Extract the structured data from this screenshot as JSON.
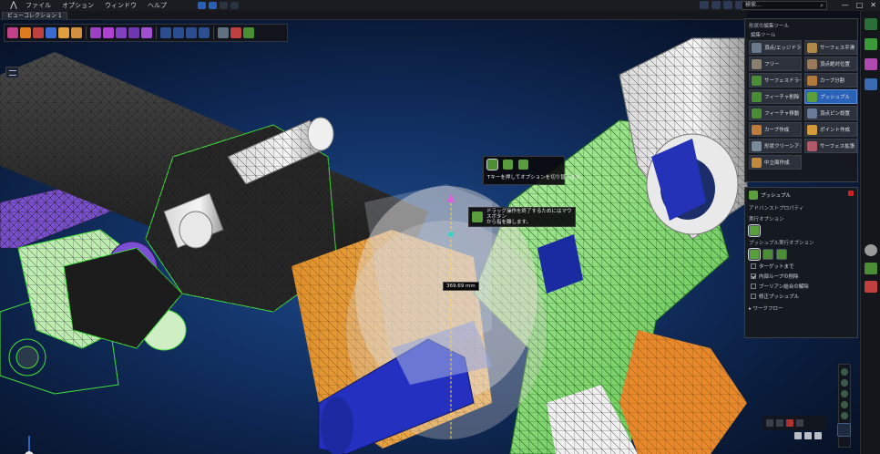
{
  "menubar": {
    "items": [
      "ファイル",
      "オプション",
      "ウィンドウ",
      "ヘルプ"
    ],
    "search_placeholder": "検索...",
    "window_controls": [
      "—",
      "□",
      "✕"
    ]
  },
  "tabs": {
    "active": "ビューコレクション 1"
  },
  "tooltips": {
    "toggle_text": "Tキーを押してオプションを切り替えます。",
    "drag_line1": "ドラッグ操作を終了するためにはマウスボタン",
    "drag_line2": "から指を離します。",
    "dimension": "369.69 mm"
  },
  "tools_panel": {
    "header": "形状の編集ツール",
    "sub_header": "編集ツール",
    "tools": [
      {
        "label": "頂点/エッジドラッグ",
        "icon": "drag-vertex-icon",
        "color": "#6a7a8a",
        "active": false
      },
      {
        "label": "サーフェス平滑",
        "icon": "smooth-surface-icon",
        "color": "#b08a48",
        "active": false
      },
      {
        "label": "フリー",
        "icon": "free-icon",
        "color": "#8a8070",
        "active": false
      },
      {
        "label": "頂点絶対位置",
        "icon": "vertex-absolute-icon",
        "color": "#9a7a5a",
        "active": false
      },
      {
        "label": "サーフェスドライブ",
        "icon": "surface-drive-icon",
        "color": "#4a8d34",
        "active": false
      },
      {
        "label": "カーブ分割",
        "icon": "curve-split-icon",
        "color": "#b27a3a",
        "active": false
      },
      {
        "label": "フィーチャ削除",
        "icon": "feature-delete-icon",
        "color": "#4a8d34",
        "active": false
      },
      {
        "label": "プッシュプル",
        "icon": "push-pull-icon",
        "color": "#5a9d3c",
        "active": true
      },
      {
        "label": "フィーチャ移動",
        "icon": "feature-move-icon",
        "color": "#4a8d34",
        "active": false
      },
      {
        "label": "頂点ピン設置",
        "icon": "vertex-pin-icon",
        "color": "#6a7a9a",
        "active": false
      },
      {
        "label": "カーブ作成",
        "icon": "curve-create-icon",
        "color": "#c07a3a",
        "active": false
      },
      {
        "label": "ポイント作成",
        "icon": "point-create-icon",
        "color": "#d49a3a",
        "active": false
      },
      {
        "label": "形状クリーンアップ",
        "icon": "cleanup-icon",
        "color": "#7a8a9a",
        "active": false
      },
      {
        "label": "サーフェス拡張",
        "icon": "surface-extend-icon",
        "color": "#b05a6a",
        "active": false
      },
      {
        "label": "中立面作成",
        "icon": "midplane-icon",
        "color": "#c08a3a",
        "active": false
      }
    ]
  },
  "push_panel": {
    "title": "プッシュプル",
    "section_exec": "アドバンストプロパティ",
    "exec_options_label": "実行オプション",
    "pushpull_options_label": "プッシュプル実行オプション",
    "checks": [
      {
        "label": "ターゲットまで",
        "checked": false
      },
      {
        "label": "内部ループの削除",
        "checked": true
      },
      {
        "label": "ブーリアン結合の解除",
        "checked": false
      },
      {
        "label": "修正プッシュプル",
        "checked": false
      }
    ],
    "workflow": "ワークフロー"
  }
}
